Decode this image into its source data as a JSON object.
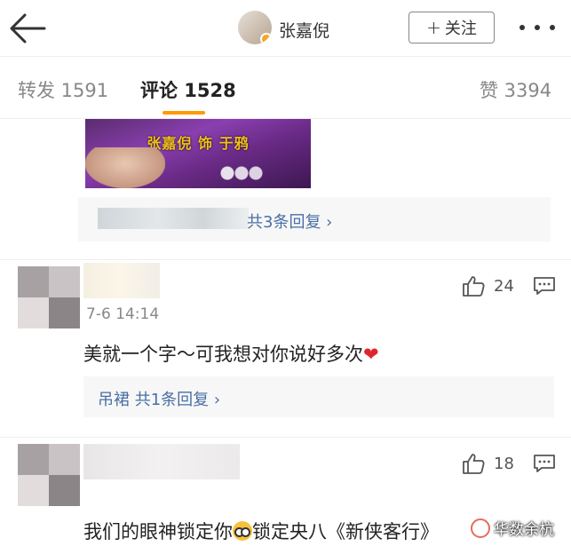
{
  "header": {
    "author_name": "张嘉倪",
    "follow_label": "关注",
    "follow_plus": "+"
  },
  "tabs": [
    {
      "label": "转发 1591",
      "active": false
    },
    {
      "label": "评论 1528",
      "active": true
    },
    {
      "label": "赞 3394",
      "active": false
    }
  ],
  "top_comment": {
    "media_caption_top": "",
    "media_caption": "张嘉倪 饰 于鸦",
    "reply_summary": "共3条回复 ›"
  },
  "comments": [
    {
      "time": "7-6 14:14",
      "text": "美就一个字～可我想对你说好多次",
      "heart": "❤",
      "likes": "24",
      "sub_replies": "吊裙  共1条回复 ›"
    },
    {
      "likes": "18",
      "text_before": "我们的眼神锁定你",
      "text_after": "锁定央八《新侠客行》"
    }
  ],
  "watermark": {
    "text": "华数余杭"
  },
  "colors": {
    "accent": "#ff9900",
    "link": "#4a6fa5",
    "heart": "#e0262b"
  }
}
